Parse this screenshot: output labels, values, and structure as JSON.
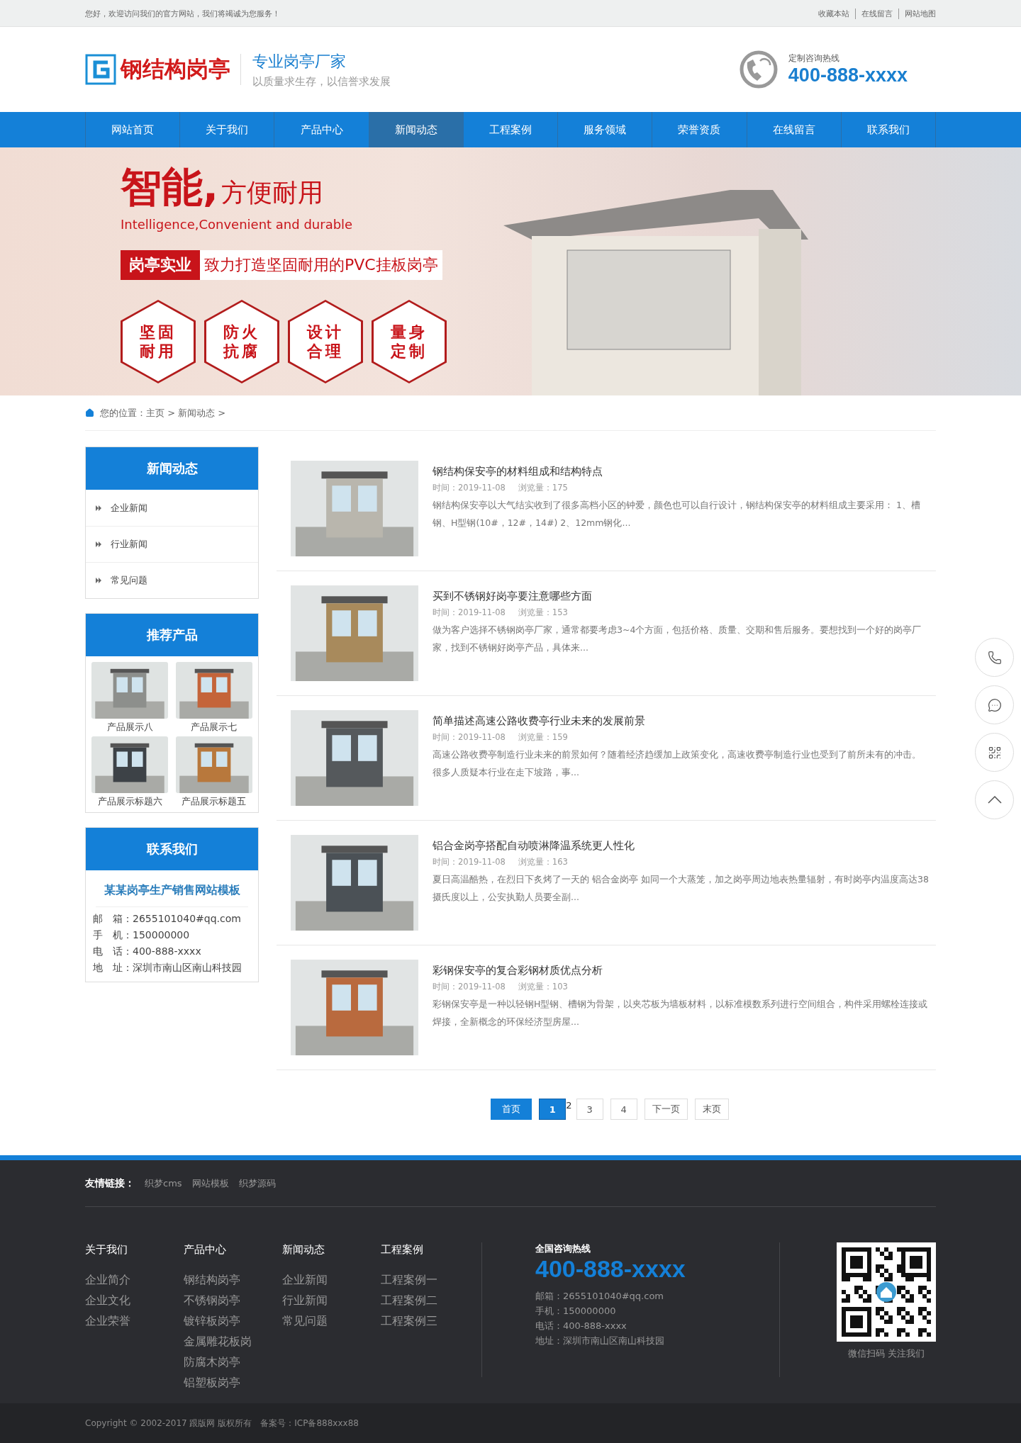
{
  "topbar": {
    "welcome": "您好，欢迎访问我们的官方网站，我们将竭诚为您服务！",
    "links": [
      "收藏本站",
      "在线留言",
      "网站地图"
    ]
  },
  "header": {
    "logo_text": "钢结构岗亭",
    "slogan": "专业岗亭厂家",
    "subslogan": "以质量求生存，以信誉求发展",
    "hotline_label": "定制咨询热线",
    "hotline": "400-888-xxxx"
  },
  "nav": [
    {
      "label": "网站首页",
      "selected": false
    },
    {
      "label": "关于我们",
      "selected": false
    },
    {
      "label": "产品中心",
      "selected": false
    },
    {
      "label": "新闻动态",
      "selected": true
    },
    {
      "label": "工程案例",
      "selected": false
    },
    {
      "label": "服务领域",
      "selected": false
    },
    {
      "label": "荣誉资质",
      "selected": false
    },
    {
      "label": "在线留言",
      "selected": false
    },
    {
      "label": "联系我们",
      "selected": false
    }
  ],
  "banner": {
    "headline_bold": "智能,",
    "headline": "方便耐用",
    "english": "Intelligence,Convenient and durable",
    "tag": "岗亭实业",
    "tagline": "致力打造坚固耐用的PVC挂板岗亭",
    "features": [
      [
        "坚固",
        "耐用"
      ],
      [
        "防火",
        "抗腐"
      ],
      [
        "设计",
        "合理"
      ],
      [
        "量身",
        "定制"
      ]
    ]
  },
  "breadcrumb": {
    "text": "您的位置：主页 > 新闻动态 >"
  },
  "sidebar": {
    "news_title": "新闻动态",
    "news_items": [
      "企业新闻",
      "行业新闻",
      "常见问题"
    ],
    "products_title": "推荐产品",
    "products": [
      {
        "name": "产品展示八",
        "color": "#8d8f8c"
      },
      {
        "name": "产品展示七",
        "color": "#c4643a"
      },
      {
        "name": "产品展示标题六",
        "color": "#3d4247"
      },
      {
        "name": "产品展示标题五",
        "color": "#b8783c"
      }
    ],
    "contact_title": "联系我们",
    "company": "某某岗亭生产销售网站模板",
    "contacts": [
      {
        "label": "邮　箱：",
        "value": "2655101040#qq.com"
      },
      {
        "label": "手　机：",
        "value": "150000000"
      },
      {
        "label": "电　话：",
        "value": "400-888-xxxx"
      },
      {
        "label": "地　址：",
        "value": "深圳市南山区南山科技园"
      }
    ]
  },
  "news": [
    {
      "title": "钢结构保安亭的材料组成和结构特点",
      "date": "时间：2019-11-08",
      "views": "浏览量：175",
      "summary": "钢结构保安亭以大气结实收到了很多高档小区的钟爱，颜色也可以自行设计，钢结构保安亭的材料组成主要采用： 1、槽钢、H型钢(10#，12#，14#) 2、12mm钢化...",
      "color": "#b9b6ad"
    },
    {
      "title": "买到不锈钢好岗亭要注意哪些方面",
      "date": "时间：2019-11-08",
      "views": "浏览量：153",
      "summary": "做为客户选择不锈钢岗亭厂家，通常都要考虑3~4个方面，包括价格、质量、交期和售后服务。要想找到一个好的岗亭厂家，找到不锈钢好岗亭产品，具体来...",
      "color": "#a88a5c"
    },
    {
      "title": "简单描述高速公路收费亭行业未来的发展前景",
      "date": "时间：2019-11-08",
      "views": "浏览量：159",
      "summary": "高速公路收费亭制造行业未来的前景如何？随着经济趋缓加上政策变化，高速收费亭制造行业也受到了前所未有的冲击。很多人质疑本行业在走下坡路，事...",
      "color": "#55595c"
    },
    {
      "title": "铝合金岗亭搭配自动喷淋降温系统更人性化",
      "date": "时间：2019-11-08",
      "views": "浏览量：163",
      "summary": "夏日高温酷热，在烈日下炙烤了一天的 铝合金岗亭 如同一个大蒸笼，加之岗亭周边地表热量辐射，有时岗亭内温度高达38摄氏度以上，公安执勤人员要全副...",
      "color": "#4b5156"
    },
    {
      "title": "彩钢保安亭的复合彩钢材质优点分析",
      "date": "时间：2019-11-08",
      "views": "浏览量：103",
      "summary": "彩钢保安亭是一种以轻钢H型钢、槽钢为骨架，以夹芯板为墙板材料，以标准模数系列进行空间组合，构件采用螺栓连接或焊接，全新概念的环保经济型房屋...",
      "color": "#b96a3e"
    }
  ],
  "pagination": [
    {
      "label": "首页",
      "kind": "button",
      "selected": false
    },
    {
      "label": "1",
      "kind": "page",
      "selected": true
    },
    {
      "label": "2",
      "kind": "bare",
      "selected": false
    },
    {
      "label": "3",
      "kind": "page",
      "selected": false
    },
    {
      "label": "4",
      "kind": "page",
      "selected": false
    },
    {
      "label": "下一页",
      "kind": "page",
      "selected": false
    },
    {
      "label": "末页",
      "kind": "page",
      "selected": false
    }
  ],
  "footer": {
    "links_label": "友情链接：",
    "links": [
      "织梦cms",
      "网站模板",
      "织梦源码"
    ],
    "columns": [
      {
        "title": "关于我们",
        "items": [
          "企业简介",
          "企业文化",
          "企业荣誉"
        ]
      },
      {
        "title": "产品中心",
        "items": [
          "钢结构岗亭",
          "不锈钢岗亭",
          "镀锌板岗亭",
          "金属雕花板岗",
          "防腐木岗亭",
          "铝塑板岗亭"
        ]
      },
      {
        "title": "新闻动态",
        "items": [
          "企业新闻",
          "行业新闻",
          "常见问题"
        ]
      },
      {
        "title": "工程案例",
        "items": [
          "工程案例一",
          "工程案例二",
          "工程案例三"
        ]
      }
    ],
    "hotline_label": "全国咨询热线",
    "hotline": "400-888-xxxx",
    "contacts": [
      "邮箱：2655101040#qq.com",
      "手机：150000000",
      "电话：400-888-xxxx",
      "地址：深圳市南山区南山科技园"
    ],
    "qr_caption": "微信扫码 关注我们",
    "copyright": "Copyright © 2002-2017 跟版网 版权所有　备案号：ICP备888xxx88"
  }
}
